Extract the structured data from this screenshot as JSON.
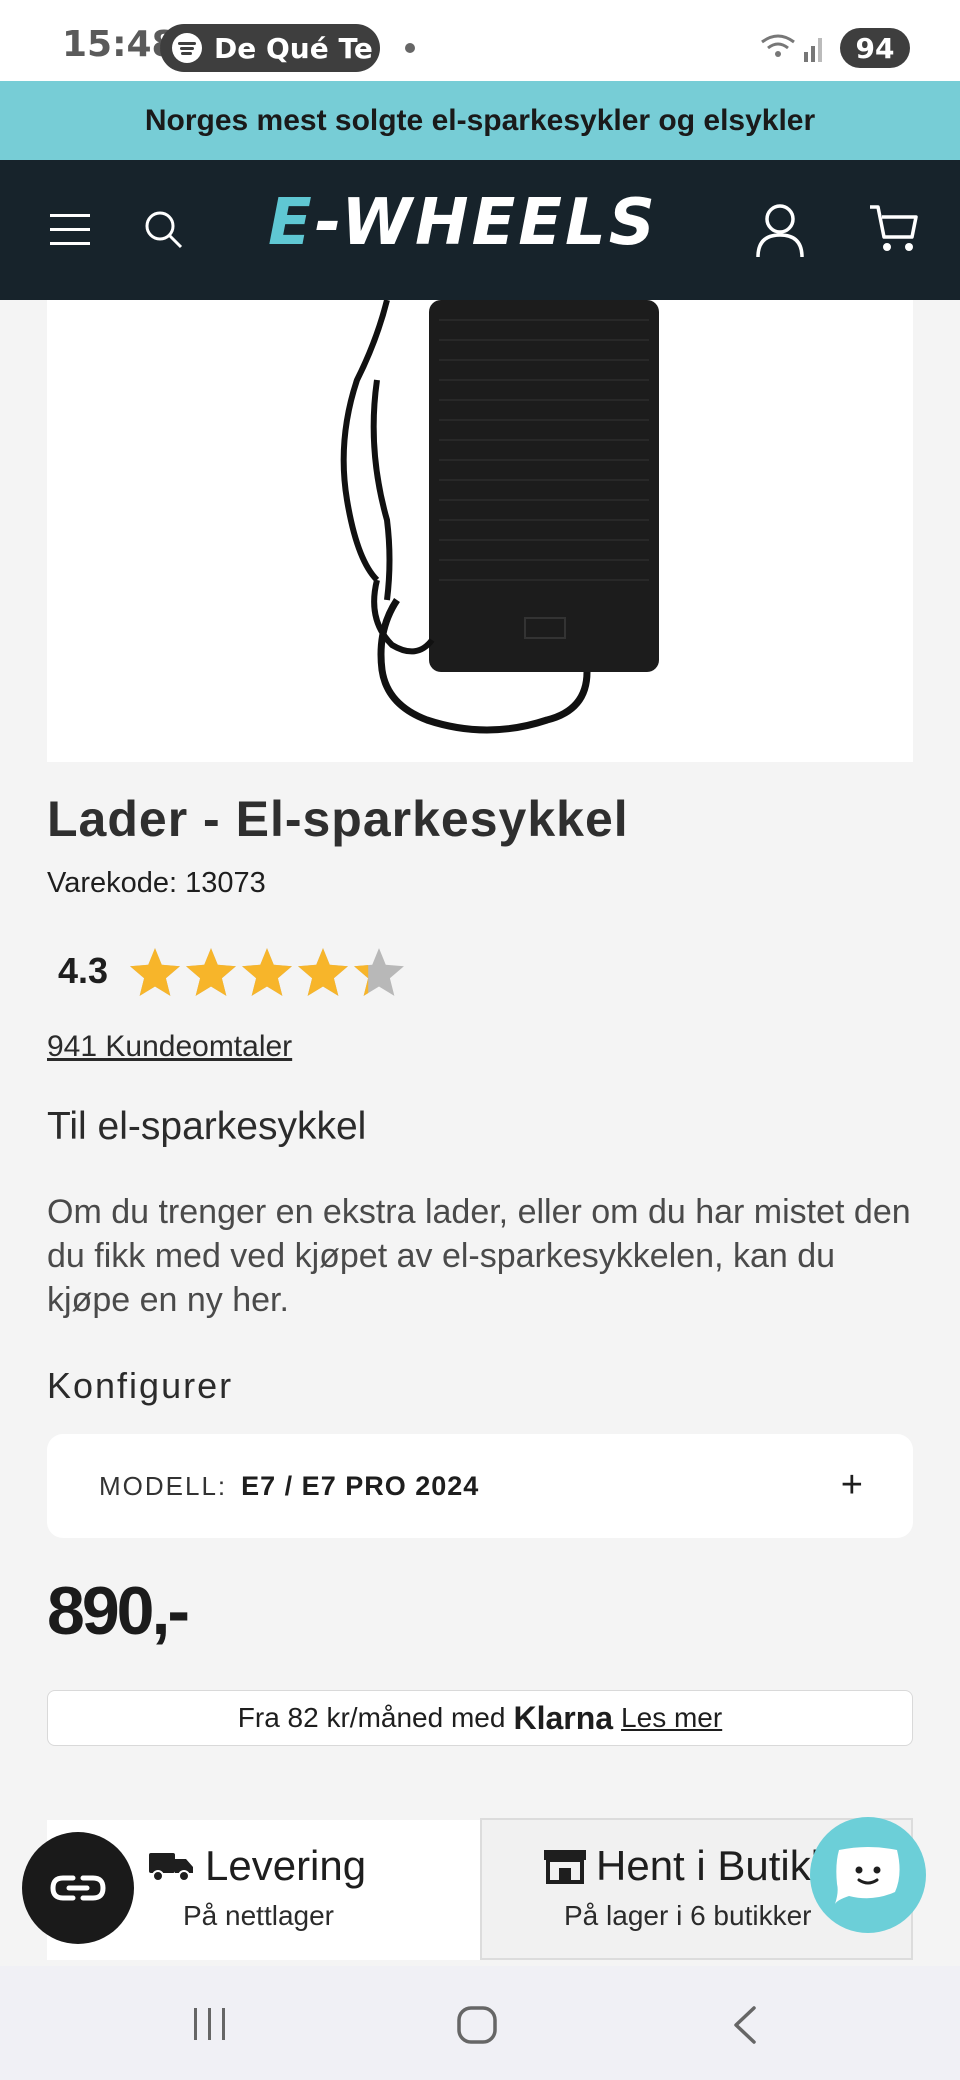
{
  "status_bar": {
    "time": "15:48",
    "media_text": "De Qué Te",
    "battery": "94"
  },
  "promo": {
    "text": "Norges mest solgte el-sparkesykler og elsykler",
    "bg_color": "#77cdd6"
  },
  "header": {
    "logo_text": "E-WHEELS",
    "bg_color": "#17232b",
    "icons": [
      "menu-icon",
      "search-icon",
      "account-icon",
      "cart-icon"
    ]
  },
  "product": {
    "title": "Lader - El-sparkesykkel",
    "sku": "Varekode: 13073",
    "rating": "4.3",
    "rating_value": 4.3,
    "rating_max": 5,
    "reviews_link": "941 Kundeomtaler",
    "subtitle": "Til el-sparkesykkel",
    "description": "Om du trenger en ekstra lader, eller om du har mistet den du fikk med ved kjøpet av el-sparkesykkelen, kan du kjøpe en ny her.",
    "config_label": "Konfigurer",
    "option": {
      "label": "MODELL:",
      "value": "E7 / E7 PRO 2024",
      "expand_symbol": "+"
    },
    "price": "890,-"
  },
  "klarna": {
    "prefix": "Fra 82 kr/måned med",
    "brand": "Klarna",
    "link": "Les mer"
  },
  "fulfillment": {
    "delivery": {
      "title": "Levering",
      "subtitle": "På nettlager"
    },
    "pickup": {
      "title": "Hent i Butikk",
      "subtitle": "På lager i 6 butikker"
    }
  },
  "colors": {
    "accent": "#6ccfd8",
    "star": "#f7b52a",
    "star_empty": "#b8b8b8"
  }
}
